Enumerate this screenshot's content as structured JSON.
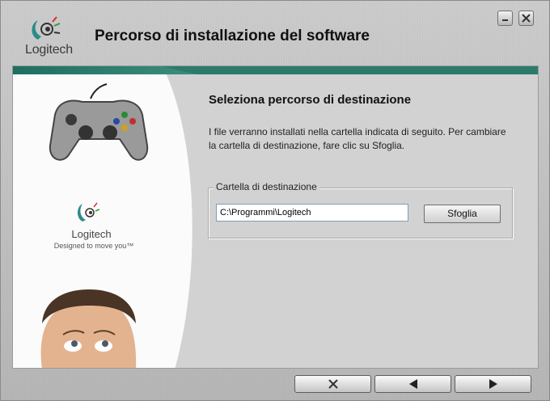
{
  "window": {
    "title": "Percorso di installazione del software",
    "brand_name": "Logitech"
  },
  "sidebar": {
    "brand_name": "Logitech",
    "tagline": "Designed to move you™"
  },
  "content": {
    "heading": "Seleziona percorso di destinazione",
    "description": "I file verranno installati nella cartella indicata di seguito. Per cambiare la cartella di destinazione, fare clic su Sfoglia.",
    "destination_group": {
      "label": "Cartella di destinazione",
      "path_value": "C:\\Programmi\\Logitech",
      "browse_label": "Sfoglia"
    }
  },
  "buttons": {
    "cancel_icon": "close-x-icon",
    "back_icon": "arrow-left-icon",
    "next_icon": "arrow-right-icon"
  },
  "colors": {
    "accent_teal": "#2d7a6a",
    "panel_bg": "#d2d2d2"
  }
}
